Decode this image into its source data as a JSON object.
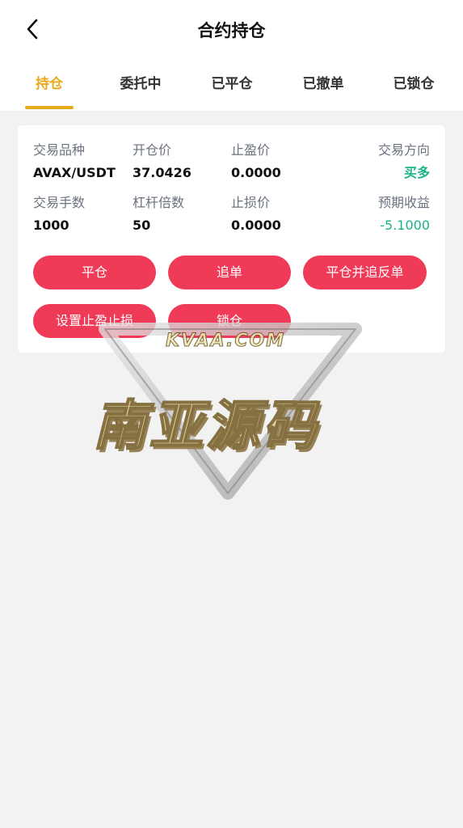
{
  "header": {
    "title": "合约持仓",
    "back_icon": "chevron-left-icon"
  },
  "tabs": [
    {
      "label": "持仓",
      "active": true
    },
    {
      "label": "委托中",
      "active": false
    },
    {
      "label": "已平仓",
      "active": false
    },
    {
      "label": "已撤单",
      "active": false
    },
    {
      "label": "已锁仓",
      "active": false
    }
  ],
  "position": {
    "symbol_label": "交易品种",
    "symbol": "AVAX/USDT",
    "open_price_label": "开仓价",
    "open_price": "37.0426",
    "take_profit_label": "止盈价",
    "take_profit": "0.0000",
    "direction_label": "交易方向",
    "direction": "买多",
    "lots_label": "交易手数",
    "lots": "1000",
    "leverage_label": "杠杆倍数",
    "leverage": "50",
    "stop_loss_label": "止损价",
    "stop_loss": "0.0000",
    "expected_profit_label": "预期收益",
    "expected_profit": "-5.1000"
  },
  "actions": {
    "close": "平仓",
    "chase": "追单",
    "close_and_reverse": "平仓并追反单",
    "set_tp_sl": "设置止盈止损",
    "lock": "锁仓"
  },
  "watermark": {
    "brand": "南亚源码",
    "domain_text": "KVAA.COM"
  },
  "colors": {
    "accent": "#e8a91a",
    "button": "#ef3b57",
    "positive": "#19b38a",
    "background": "#f2f2f2"
  }
}
